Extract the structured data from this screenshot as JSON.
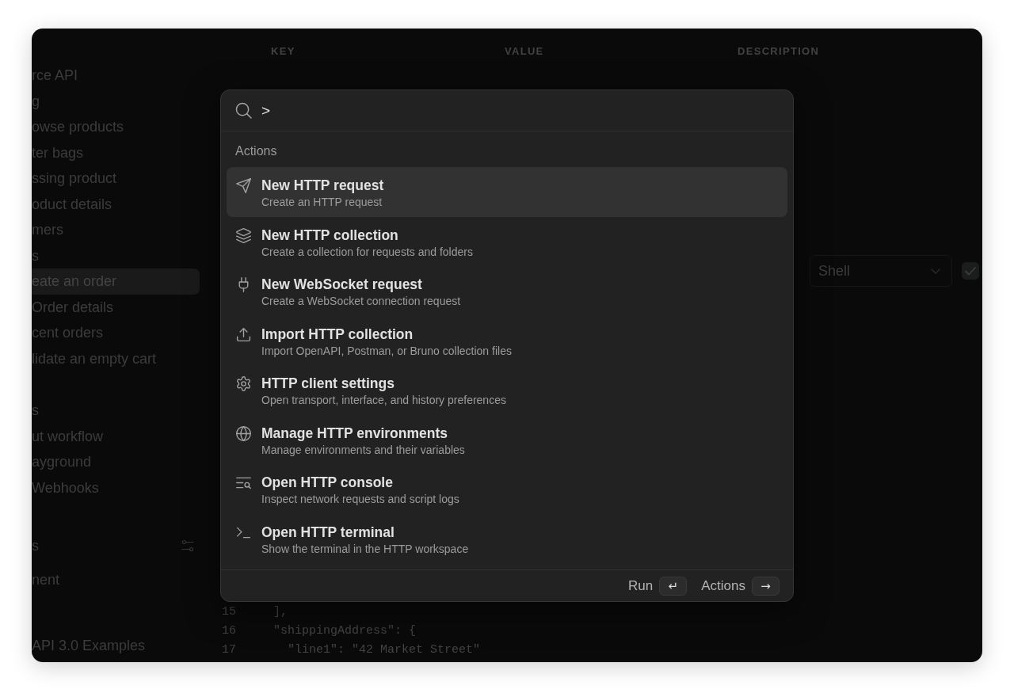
{
  "sidebar": {
    "groups": [
      {
        "items": [
          {
            "label": "rce API",
            "selected": false
          },
          {
            "label": "g",
            "selected": false
          },
          {
            "label": "owse products",
            "selected": false
          },
          {
            "label": "ter bags",
            "selected": false
          },
          {
            "label": "ssing product",
            "selected": false
          },
          {
            "label": "oduct details",
            "selected": false
          },
          {
            "label": "mers",
            "selected": false
          },
          {
            "label": "s",
            "selected": false
          },
          {
            "label": "eate an order",
            "selected": true
          },
          {
            "label": "Order details",
            "selected": false
          },
          {
            "label": "cent orders",
            "selected": false
          },
          {
            "label": "lidate an empty cart",
            "selected": false
          }
        ]
      },
      {
        "items": [
          {
            "label": "s",
            "selected": false
          },
          {
            "label": "ut workflow",
            "selected": false
          },
          {
            "label": "ayground",
            "selected": false
          },
          {
            "label": "Webhooks",
            "selected": false
          }
        ]
      },
      {
        "heading": "s",
        "items": [
          {
            "label": "nent",
            "selected": false
          }
        ]
      }
    ],
    "footer": "API 3.0 Examples"
  },
  "params_table": {
    "columns": [
      "KEY",
      "VALUE",
      "DESCRIPTION"
    ]
  },
  "shell_row": {
    "select": {
      "value": "Shell"
    },
    "checkbox": {
      "checked": true
    }
  },
  "code": {
    "lines": [
      {
        "number": "15",
        "text": "  ],"
      },
      {
        "number": "16",
        "text": "  \"shippingAddress\": {"
      },
      {
        "number": "17",
        "text": "    \"line1\": \"42 Market Street\""
      }
    ]
  },
  "palette": {
    "search": {
      "value": ">"
    },
    "section": "Actions",
    "items": [
      {
        "title": "New HTTP request",
        "subtitle": "Create an HTTP request",
        "selected": true
      },
      {
        "title": "New HTTP collection",
        "subtitle": "Create a collection for requests and folders",
        "selected": false
      },
      {
        "title": "New WebSocket request",
        "subtitle": "Create a WebSocket connection request",
        "selected": false
      },
      {
        "title": "Import HTTP collection",
        "subtitle": "Import OpenAPI, Postman, or Bruno collection files",
        "selected": false
      },
      {
        "title": "HTTP client settings",
        "subtitle": "Open transport, interface, and history preferences",
        "selected": false
      },
      {
        "title": "Manage HTTP environments",
        "subtitle": "Manage environments and their variables",
        "selected": false
      },
      {
        "title": "Open HTTP console",
        "subtitle": "Inspect network requests and script logs",
        "selected": false
      },
      {
        "title": "Open HTTP terminal",
        "subtitle": "Show the terminal in the HTTP workspace",
        "selected": false
      }
    ],
    "footer": [
      {
        "label": "Run",
        "key": "↵"
      },
      {
        "label": "Actions",
        "key": "→"
      }
    ]
  }
}
